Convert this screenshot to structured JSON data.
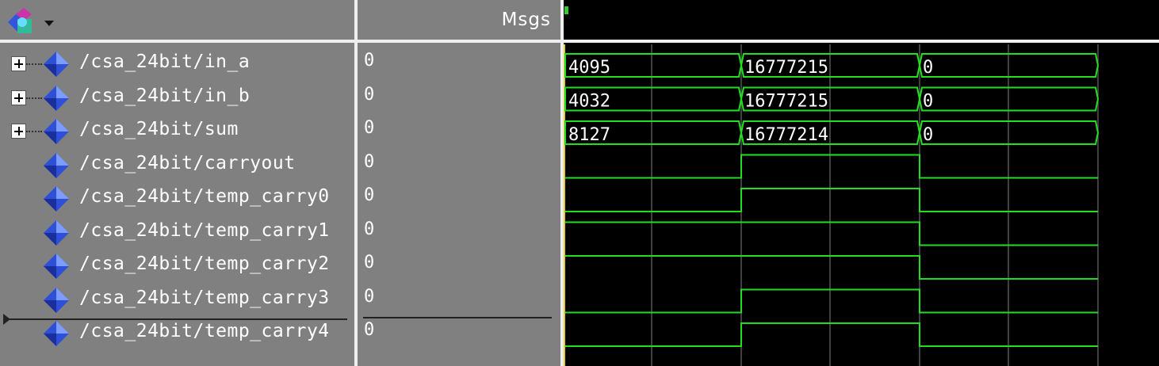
{
  "header": {
    "msgs_label": "Msgs"
  },
  "colors": {
    "panel_bg": "#808080",
    "wave_bg": "#000000",
    "wave_green": "#22dd22",
    "grid": "#555555",
    "bus_text": "#ffffff"
  },
  "signals": [
    {
      "name": "/csa_24bit/in_a",
      "value": "0",
      "type": "bus",
      "expandable": true,
      "segments": [
        {
          "label": "4095"
        },
        {
          "label": "16777215"
        },
        {
          "label": "0"
        }
      ]
    },
    {
      "name": "/csa_24bit/in_b",
      "value": "0",
      "type": "bus",
      "expandable": true,
      "segments": [
        {
          "label": "4032"
        },
        {
          "label": "16777215"
        },
        {
          "label": "0"
        }
      ]
    },
    {
      "name": "/csa_24bit/sum",
      "value": "0",
      "type": "bus",
      "expandable": true,
      "segments": [
        {
          "label": "8127"
        },
        {
          "label": "16777214"
        },
        {
          "label": "0"
        }
      ]
    },
    {
      "name": "/csa_24bit/carryout",
      "value": "0",
      "type": "bit",
      "expandable": false,
      "levels": [
        0,
        1,
        0
      ]
    },
    {
      "name": "/csa_24bit/temp_carry0",
      "value": "0",
      "type": "bit",
      "expandable": false,
      "levels": [
        0,
        1,
        0
      ]
    },
    {
      "name": "/csa_24bit/temp_carry1",
      "value": "0",
      "type": "bit",
      "expandable": false,
      "levels": [
        1,
        1,
        0
      ]
    },
    {
      "name": "/csa_24bit/temp_carry2",
      "value": "0",
      "type": "bit",
      "expandable": false,
      "levels": [
        1,
        1,
        0
      ]
    },
    {
      "name": "/csa_24bit/temp_carry3",
      "value": "0",
      "type": "bit",
      "expandable": false,
      "levels": [
        0,
        1,
        0
      ]
    },
    {
      "name": "/csa_24bit/temp_carry4",
      "value": "0",
      "type": "bit",
      "expandable": false,
      "levels": [
        0,
        1,
        0
      ]
    }
  ]
}
